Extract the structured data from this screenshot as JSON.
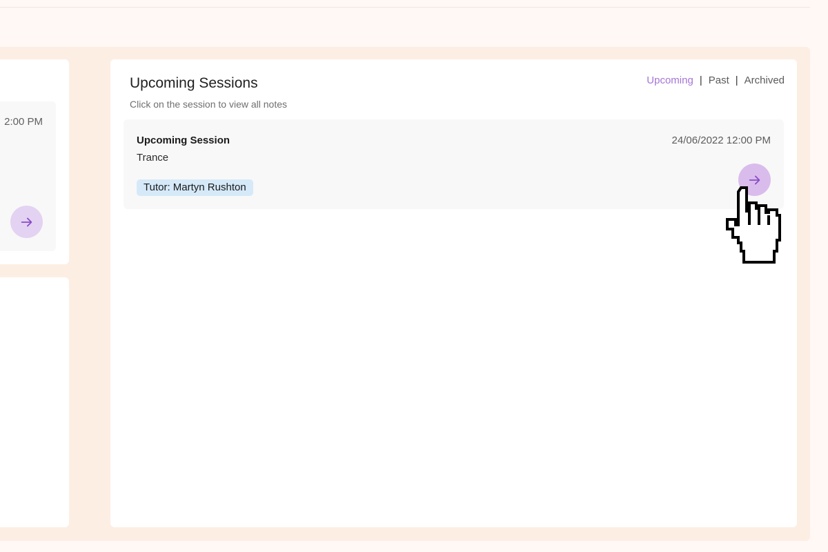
{
  "left_panel": {
    "time_fragment": "2:00 PM"
  },
  "main": {
    "title": "Upcoming Sessions",
    "subtitle": "Click on the session to view all notes",
    "filters": {
      "upcoming": "Upcoming",
      "past": "Past",
      "archived": "Archived",
      "separator": "|",
      "active": "Upcoming"
    },
    "session": {
      "title": "Upcoming Session",
      "subtitle": "Trance",
      "datetime": "24/06/2022 12:00 PM",
      "tutor": "Tutor: Martyn Rushton",
      "arrow_icon": "arrow-right-icon"
    }
  },
  "colors": {
    "accent": "#a475d6",
    "arrow_bg": "#d9bcec",
    "tutor_badge_bg": "#d5e9f9",
    "panel_bg": "#fdeee4",
    "page_bg": "#fff8f5"
  }
}
